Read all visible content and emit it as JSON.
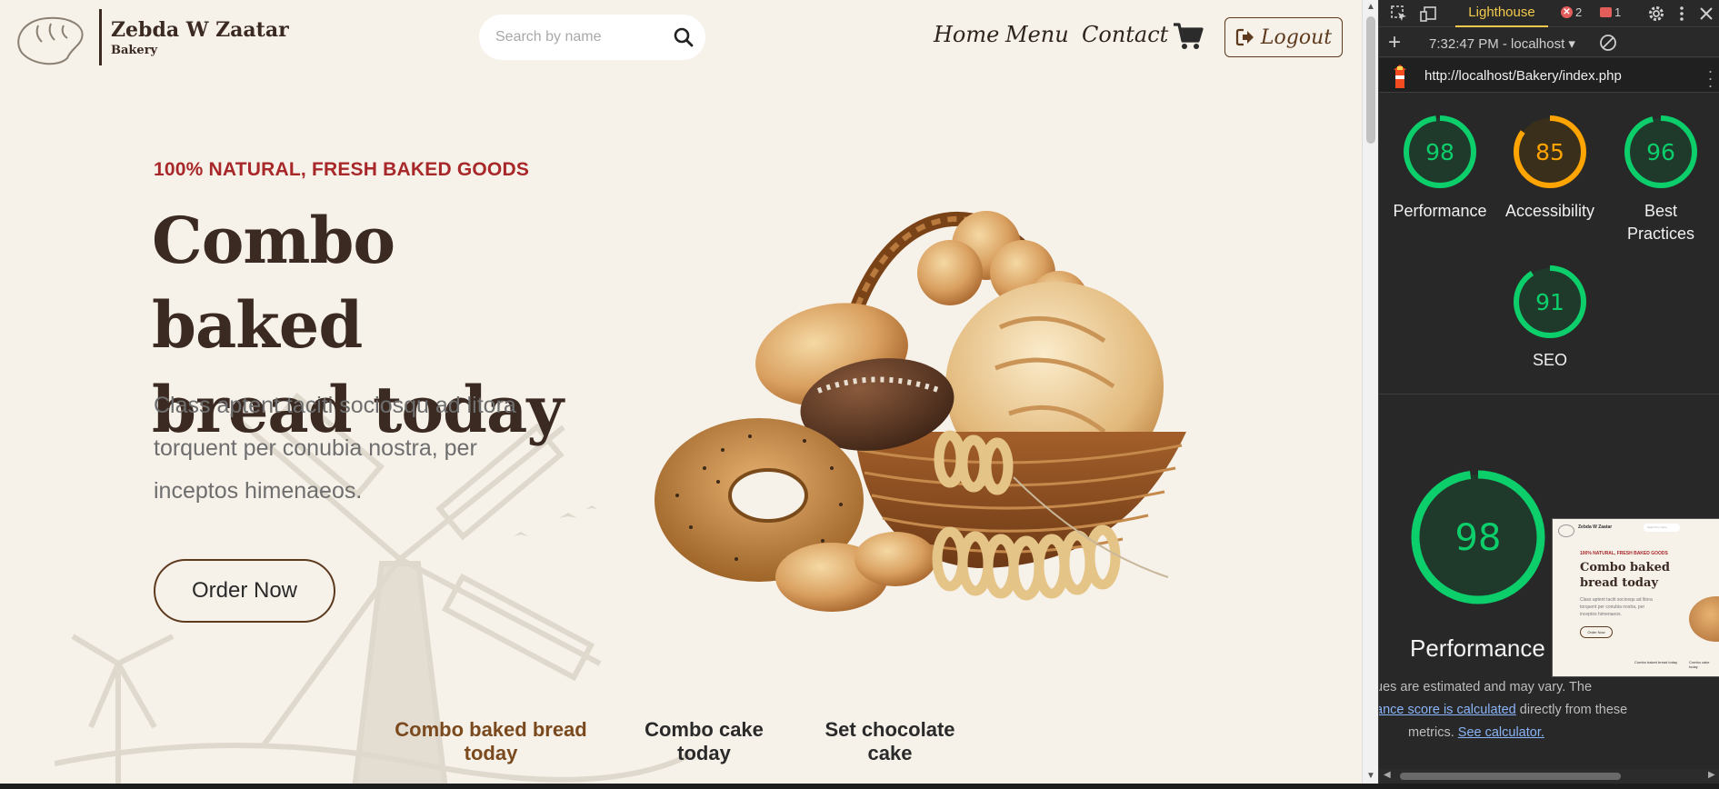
{
  "site": {
    "brand": {
      "name": "Zebda W Zaatar",
      "sub": "Bakery"
    },
    "search": {
      "placeholder": "Search by name"
    },
    "nav": [
      {
        "label": "Home"
      },
      {
        "label": "Menu"
      },
      {
        "label": "Contact"
      }
    ],
    "logout_label": "Logout",
    "hero": {
      "tagline": "100% NATURAL, FRESH BAKED GOODS",
      "title_line1": "Combo baked",
      "title_line2": "bread today",
      "desc_line1": "Class aptent taciti sociosqu ad litora",
      "desc_line2": "torquent per conubia nostra, per",
      "desc_line3": "inceptos himenaeos.",
      "order_label": "Order Now"
    },
    "categories": [
      {
        "line1": "Combo baked bread",
        "line2": "today",
        "active": true
      },
      {
        "line1": "Combo cake",
        "line2": "today",
        "active": false
      },
      {
        "line1": "Set chocolate",
        "line2": "cake",
        "active": false
      }
    ],
    "colors": {
      "background": "#f6f1e9",
      "accent": "#a8282a",
      "brown": "#5d3a1e",
      "title": "#3a2a22"
    }
  },
  "devtools": {
    "active_tab": "Lighthouse",
    "errors": "2",
    "issues": "1",
    "run_label": "7:32:47 PM - localhost",
    "url": "http://localhost/Bakery/index.php",
    "scores": [
      {
        "value": 98,
        "label_line1": "Performance",
        "label_line2": "",
        "color": "#0cce6b"
      },
      {
        "value": 85,
        "label_line1": "Accessibility",
        "label_line2": "",
        "color": "#ffa400"
      },
      {
        "value": 96,
        "label_line1": "Best",
        "label_line2": "Practices",
        "color": "#0cce6b"
      },
      {
        "value": 91,
        "label_line1": "SEO",
        "label_line2": "",
        "color": "#0cce6b"
      }
    ],
    "main_score": {
      "value": 98,
      "label": "Performance",
      "color": "#0cce6b"
    },
    "note": {
      "line1": "ues are estimated and may vary. The",
      "link1": "ance score is calculated",
      "line2_rest": " directly from these",
      "line3": "metrics. ",
      "link2": "See calculator."
    },
    "thumbnail": {
      "brand": "Zebda W Zaatar",
      "search": "Search by name",
      "tagline": "100% NATURAL, FRESH BAKED GOODS",
      "title": "Combo baked bread today",
      "desc": "Class aptent taciti sociosqu ad litora torquent per conubia nostra, per inceptos himenaeos.",
      "button": "Order Now",
      "cat1": "Combo baked bread today",
      "cat2": "Combo cake today"
    }
  }
}
